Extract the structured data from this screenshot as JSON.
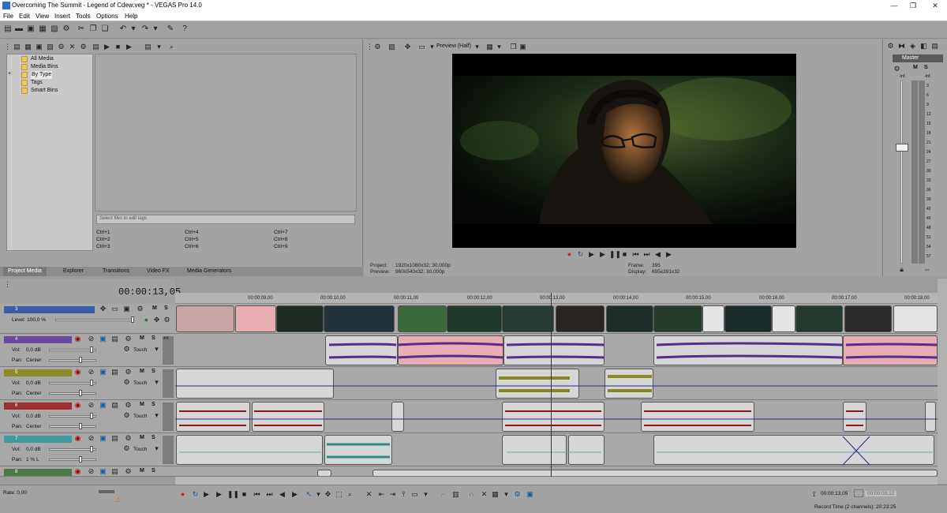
{
  "window": {
    "title": "Overcoming The Summit - Legend of Cdew.veg * - VEGAS Pro 14.0",
    "minimize": "—",
    "maximize": "❐",
    "close": "✕"
  },
  "menu": [
    "File",
    "Edit",
    "View",
    "Insert",
    "Tools",
    "Options",
    "Help"
  ],
  "project_media": {
    "tree": [
      "All Media",
      "Media Bins",
      "By Type",
      "Tags",
      "Smart Bins"
    ],
    "expand_glyph": "+",
    "tag_placeholder": "Select files to edit tags",
    "shortcuts": [
      "Ctrl+1",
      "Ctrl+2",
      "Ctrl+3",
      "Ctrl+4",
      "Ctrl+5",
      "Ctrl+6",
      "Ctrl+7",
      "Ctrl+8",
      "Ctrl+9"
    ],
    "tabs": [
      "Project Media",
      "Explorer",
      "Transitions",
      "Video FX",
      "Media Generators"
    ]
  },
  "preview": {
    "quality": "Preview (Half)",
    "project_label": "Project:",
    "project_value": "1920x1080x32; 30,000p",
    "preview_label": "Preview:",
    "preview_value": "960x540x32; 30,000p",
    "frame_label": "Frame:",
    "frame_value": "395",
    "display_label": "Display:",
    "display_value": "695x391x32"
  },
  "mixer": {
    "master_label": "Master",
    "m": "M",
    "s": "S",
    "inf_left": "-Inf.",
    "inf_right": "-Inf.",
    "scale": [
      "3",
      "6",
      "9",
      "12",
      "15",
      "18",
      "21",
      "24",
      "27",
      "30",
      "33",
      "36",
      "39",
      "42",
      "45",
      "48",
      "51",
      "54",
      "57"
    ]
  },
  "timeline": {
    "timecode": "00:00:13,05",
    "ruler": [
      "00:00:09,00",
      "00:00:10,00",
      "00:00:11,00",
      "00:00:12,00",
      "00:00:13,00",
      "00:00:14,00",
      "00:00:15,00",
      "00:00:16,00",
      "00:00:17,00",
      "00:00:18,00"
    ],
    "tracks": [
      {
        "num": "3",
        "type": "video",
        "color": "#3a5fa8",
        "level_label": "Level: 100,0 %"
      },
      {
        "num": "4",
        "type": "audio",
        "color": "#6a4aa0",
        "vol": "0,0 dB",
        "pan": "Center",
        "mode": "Touch"
      },
      {
        "num": "5",
        "type": "audio",
        "color": "#8d8a2a",
        "vol": "0,0 dB",
        "pan": "Center",
        "mode": "Touch"
      },
      {
        "num": "6",
        "type": "audio",
        "color": "#9c3030",
        "vol": "0,0 dB",
        "pan": "Center",
        "mode": "Touch"
      },
      {
        "num": "7",
        "type": "audio",
        "color": "#3f9aa0",
        "vol": "0,0 dB",
        "pan": "1 % L",
        "mode": "Touch"
      },
      {
        "num": "8",
        "type": "audio",
        "color": "#4a7a4a"
      }
    ],
    "vol_label": "Vol:",
    "pan_label": "Pan:",
    "m": "M",
    "s": "S",
    "inf": "-Inf.",
    "scale_small": [
      "3",
      "6",
      "9"
    ]
  },
  "status": {
    "rate": "Rate: 0,00",
    "cursor_time": "00:00:13,05",
    "cursor_end": "00:00:03,12",
    "record_time": "Record Time (2 channels): 20:23:25"
  }
}
